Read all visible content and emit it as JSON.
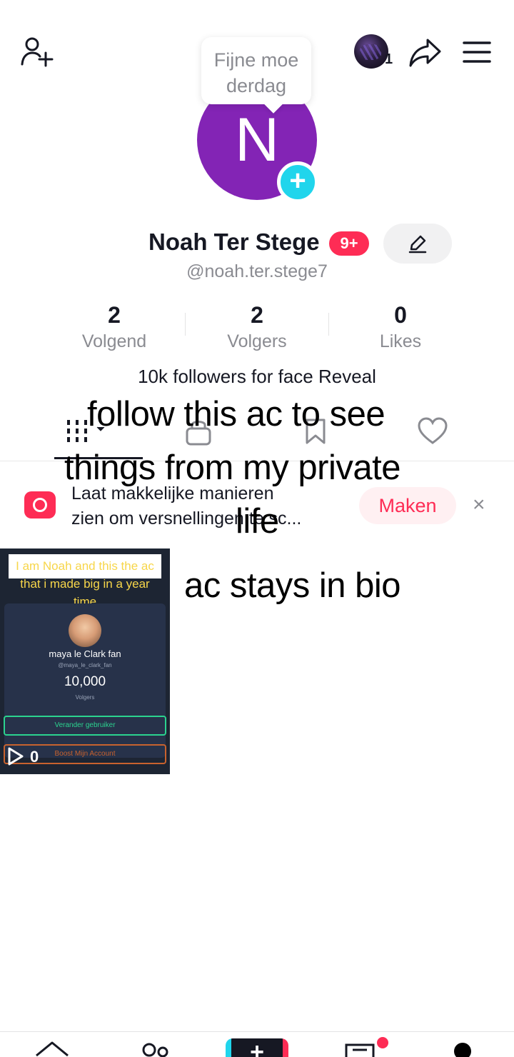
{
  "tooltip": {
    "line1": "Fijne moe",
    "line2": "derdag"
  },
  "header": {
    "story_count": "1"
  },
  "profile": {
    "avatar_initial": "N",
    "avatar_color": "#8324b5",
    "name": "Noah Ter Stege",
    "notification_badge": "9+",
    "handle": "@noah.ter.stege7",
    "bio": "10k followers for face Reveal"
  },
  "stats": [
    {
      "value": "2",
      "label": "Volgend"
    },
    {
      "value": "2",
      "label": "Volgers"
    },
    {
      "value": "0",
      "label": "Likes"
    }
  ],
  "promo": {
    "line1": "Laat makkelijke manieren",
    "line2": "zien om versnellingen te sc...",
    "button": "Maken",
    "close": "×"
  },
  "overlay_text": {
    "line1": "follow this ac to see",
    "line2": "things from my private",
    "line3": "life",
    "line4": "ac stays in bio"
  },
  "video": {
    "caption_line1": "I am Noah and this the ac",
    "caption_line2": "that i made big in a year",
    "caption_line3": "time",
    "inner_name": "maya le Clark fan",
    "inner_handle": "@maya_le_clark_fan",
    "inner_count": "10,000",
    "inner_volgers": "Volgers",
    "inner_btn1": "Verander gebruiker",
    "inner_btn2": "Boost Mijn Account",
    "views": "0"
  },
  "nav": {
    "create": "+"
  },
  "colors": {
    "accent_red": "#fe2c55",
    "accent_cyan": "#20d5ec",
    "text_primary": "#161823",
    "text_secondary": "#8a8b91"
  }
}
